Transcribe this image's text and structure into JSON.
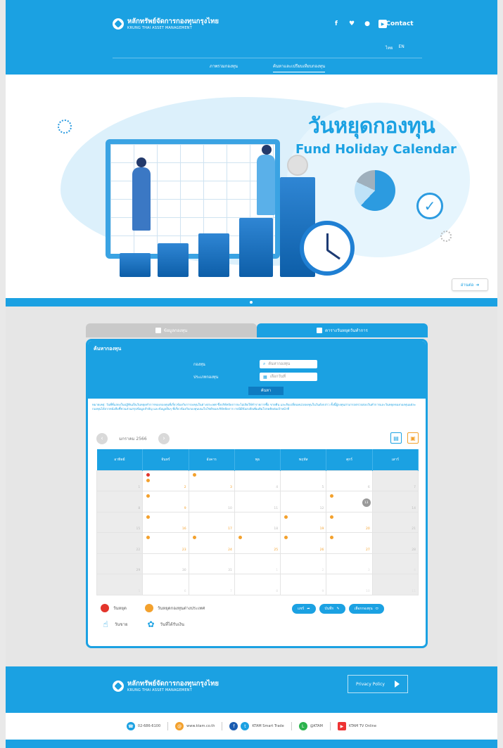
{
  "header": {
    "logo_th": "หลักทรัพย์จัดการกองทุนกรุงไทย",
    "logo_en": "KRUNG THAI ASSET MANAGEMENT",
    "social": [
      "f",
      "t",
      "line",
      "yt"
    ],
    "contact_label": "Contact",
    "lang_th": "ไทย",
    "lang_en": "EN",
    "nav": [
      "ภาพรวมกองทุน",
      "ค้นหาและเปรียบเทียบกองทุน"
    ]
  },
  "banner": {
    "title_th": "วันหยุดกองทุน",
    "title_en": "Fund Holiday Calendar",
    "more_label": "อ่านต่อ"
  },
  "tabs": {
    "tab1": "ข้อมูลกองทุน",
    "tab2": "ตารางวันหยุดวันทำการ"
  },
  "search": {
    "title": "ค้นหากองทุน",
    "fund_label": "กองทุน",
    "fund_placeholder": "ค้นหากองทุน",
    "type_label": "ประเภทกองทุน",
    "type_placeholder": "เลือกวันที่",
    "button": "ค้นหา"
  },
  "notice": "หมายเหตุ: วันที่ที่แสดงในปฏิทินเป็นวันหยุดทำการของกองทุนที่เกี่ยวข้องกับการลงทุนในต่างประเทศ ซึ่งบริษัทจัดการจะไม่เปิดให้ทำรายการซื้อ ขายคืน และสับเปลี่ยนหน่วยลงทุนในวันดังกล่าว ทั้งนี้ผู้ลงทุนสามารถตรวจสอบวันทำการและวันหยุดของกองทุนแต่ละกองทุนได้จากหนังสือชี้ชวนส่วนสรุปข้อมูลสำคัญ และข้อมูลอื่นๆ ที่เกี่ยวข้องกับกองทุนบนเว็บไซต์ของบริษัทจัดการ กรณีมีข้อสงสัยเพิ่มเติมโปรดติดต่อเจ้าหน้าที่",
  "calendar": {
    "month_label": "มกราคม 2566",
    "weekdays": [
      "อาทิตย์",
      "จันทร์",
      "อังคาร",
      "พุธ",
      "พฤหัส",
      "ศุกร์",
      "เสาร์"
    ],
    "weeks": [
      [
        "1",
        "2",
        "3",
        "4",
        "5",
        "6",
        "7"
      ],
      [
        "8",
        "9",
        "10",
        "11",
        "12",
        "13",
        "14"
      ],
      [
        "15",
        "16",
        "17",
        "18",
        "19",
        "20",
        "21"
      ],
      [
        "22",
        "23",
        "24",
        "25",
        "26",
        "27",
        "28"
      ],
      [
        "29",
        "30",
        "31",
        "1",
        "2",
        "3",
        "4"
      ],
      [
        "5",
        "6",
        "7",
        "8",
        "9",
        "10",
        "11"
      ]
    ]
  },
  "legend": {
    "holiday": "วันหยุด",
    "foreign_holiday": "วันหยุดกองทุนต่างประเทศ",
    "buy_day": "วันขาย",
    "redeem_day": "วันที่ได้รับเงิน"
  },
  "actions": {
    "share": "แชร์",
    "print": "บันทึก",
    "select_fund": "เลือกกองทุน"
  },
  "footer": {
    "logo_th": "หลักทรัพย์จัดการกองทุนกรุงไทย",
    "logo_en": "KRUNG THAI ASSET MANAGEMENT",
    "privacy": "Privacy Policy",
    "contacts": [
      {
        "icon": "phone-icon",
        "label": "02-686-6100",
        "color": "#1ba1e2"
      },
      {
        "icon": "web-icon",
        "label": "www.ktam.co.th",
        "color": "#f3a12d"
      },
      {
        "icon": "facebook-icon",
        "label": "KTAM Smart Trade",
        "color": "#1a5cb0"
      },
      {
        "icon": "line-icon",
        "label": "@KTAM",
        "color": "#2bb24c"
      },
      {
        "icon": "youtube-icon",
        "label": "KTAM TV Online",
        "color": "#e33"
      }
    ]
  },
  "colors": {
    "brand": "#1ba1e2",
    "holiday": "#e3352b",
    "foreign_holiday": "#f3a12d"
  }
}
